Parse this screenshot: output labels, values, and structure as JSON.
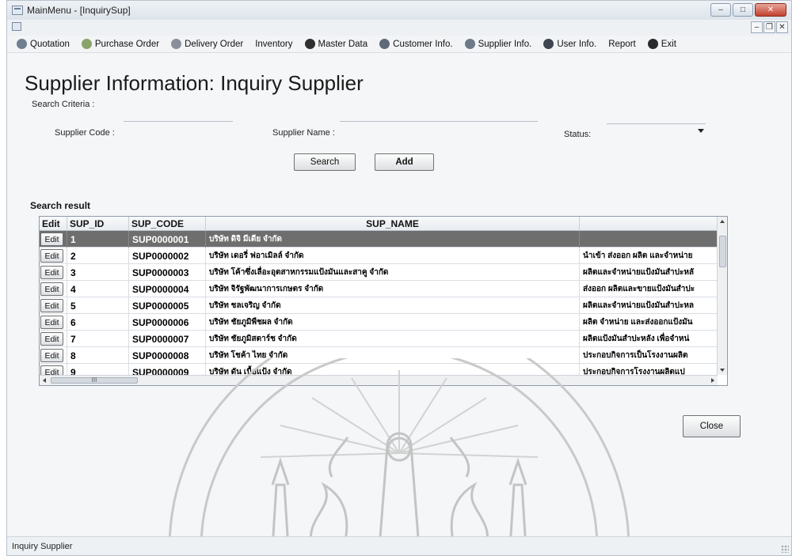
{
  "window": {
    "title": "MainMenu - [InquirySup]"
  },
  "title_buttons": {
    "minimize": "–",
    "maximize": "□",
    "close": "✕"
  },
  "mdi_buttons": {
    "minimize": "–",
    "restore": "❐",
    "close": "✕"
  },
  "menu": [
    {
      "label": "Quotation",
      "icon": "quotation-icon",
      "color": "#6f7f90"
    },
    {
      "label": "Purchase Order",
      "icon": "purchase-order-icon",
      "color": "#8aa36b"
    },
    {
      "label": "Delivery Order",
      "icon": "delivery-order-icon",
      "color": "#8a8f99"
    },
    {
      "label": "Inventory",
      "icon": "",
      "color": ""
    },
    {
      "label": "Master Data",
      "icon": "master-data-icon",
      "color": "#2f2f2f"
    },
    {
      "label": "Customer Info.",
      "icon": "customer-info-icon",
      "color": "#5e6a78"
    },
    {
      "label": "Supplier Info.",
      "icon": "supplier-info-icon",
      "color": "#6d7986"
    },
    {
      "label": "User Info.",
      "icon": "user-info-icon",
      "color": "#3f4650"
    },
    {
      "label": "Report",
      "icon": "",
      "color": ""
    },
    {
      "label": "Exit",
      "icon": "exit-icon",
      "color": "#2b2b2b"
    }
  ],
  "page": {
    "title": "Supplier Information: Inquiry Supplier",
    "search_criteria_label": "Search Criteria :",
    "supplier_code_label": "Supplier Code :",
    "supplier_code_value": "",
    "supplier_name_label": "Supplier Name :",
    "supplier_name_value": "",
    "status_label": "Status:",
    "status_value": "",
    "search_button": "Search",
    "add_button": "Add",
    "search_result_label": "Search result",
    "close_button": "Close"
  },
  "grid": {
    "columns": [
      "Edit",
      "SUP_ID",
      "SUP_CODE",
      "SUP_NAME",
      ""
    ],
    "rows": [
      {
        "edit": "Edit",
        "id": "1",
        "code": "SUP0000001",
        "name": "บริษัท ดิจิ มีเดีย จำกัด",
        "desc": "",
        "selected": true
      },
      {
        "edit": "Edit",
        "id": "2",
        "code": "SUP0000002",
        "name": "บริษัท เดอรี่ ฟอาเมิลล์ จำกัด",
        "desc": "นำเข้า ส่งออก ผลิต และจำหน่าย",
        "selected": false
      },
      {
        "edit": "Edit",
        "id": "3",
        "code": "SUP0000003",
        "name": "บริษัท โค้าซึ่งเลื่อะอุตสาหกรรมแป้งมันและสาคู จำกัด",
        "desc": "ผลิตและจำหน่ายแป้งมันสำปะหลั",
        "selected": false
      },
      {
        "edit": "Edit",
        "id": "4",
        "code": "SUP0000004",
        "name": "บริษัท จิรัฐพัฒนาการเกษตร จำกัด",
        "desc": "ส่งออก ผลิตและขายแป้งมันสำปะ",
        "selected": false
      },
      {
        "edit": "Edit",
        "id": "5",
        "code": "SUP0000005",
        "name": "บริษัท ชลเจริญ จำกัด",
        "desc": "ผลิตและจำหน่ายแป้งมันสำปะหล",
        "selected": false
      },
      {
        "edit": "Edit",
        "id": "6",
        "code": "SUP0000006",
        "name": "บริษัท ชัยภูมิพืชผล จำกัด",
        "desc": "ผลิต จำหน่าย และส่งออกแป้งมัน",
        "selected": false
      },
      {
        "edit": "Edit",
        "id": "7",
        "code": "SUP0000007",
        "name": "บริษัท ชัยภูมิสตาร์ช จำกัด",
        "desc": "ผลิตแป้งมันสำปะหลัง เพื่อจำหน่",
        "selected": false
      },
      {
        "edit": "Edit",
        "id": "8",
        "code": "SUP0000008",
        "name": "บริษัท โชค้า ไทย จำกัด",
        "desc": "ประกอบกิจการเป็นโรงงานผลิต",
        "selected": false
      },
      {
        "edit": "Edit",
        "id": "9",
        "code": "SUP0000009",
        "name": "บริษัท ดัน เนื้อแป้ง จำกัด",
        "desc": "ประกอบกิจการโรงงานผลิตแป",
        "selected": false
      }
    ],
    "hscroll_thumb": "III"
  },
  "status_bar": {
    "text": "Inquiry Supplier"
  },
  "colors": {
    "selected_row": "#6e6e6e",
    "watermark": "#c9c9c9"
  }
}
